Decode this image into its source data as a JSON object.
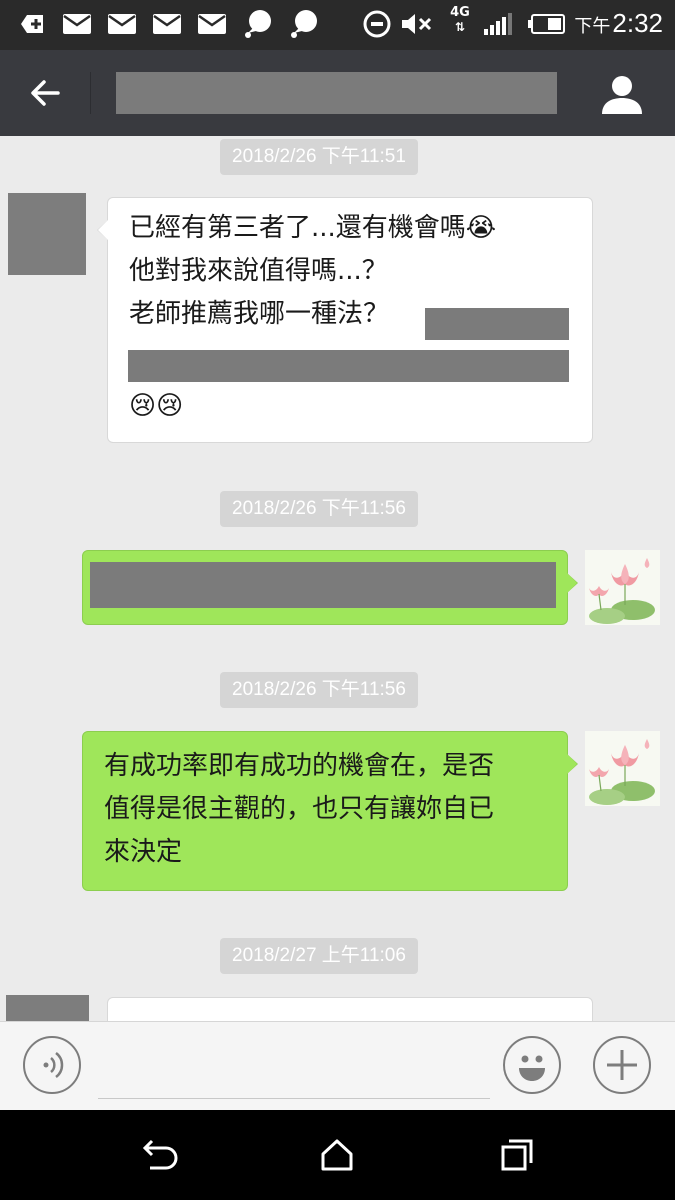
{
  "status_bar": {
    "time_prefix": "下午",
    "time": "2:32",
    "network": "4G",
    "icons": [
      "add-square-icon",
      "mail-icon",
      "mail-icon",
      "mail-icon",
      "mail-icon",
      "chat-bubble-icon",
      "chat-bubble-icon",
      "do-not-disturb-icon",
      "mute-icon",
      "network-4g-icon",
      "signal-icon",
      "battery-icon"
    ]
  },
  "header": {
    "back_icon": "arrow-left-icon",
    "profile_icon": "person-icon"
  },
  "messages": [
    {
      "timestamp": "2018/2/26 下午11:51"
    },
    {
      "sender": "contact",
      "lines": [
        "已經有第三者了...還有機會嗎😭",
        "他對我來說值得嗎...？",
        "老師推薦我哪一種法？"
      ],
      "emoji_line": "😢😢"
    },
    {
      "timestamp": "2018/2/26 下午11:56"
    },
    {
      "timestamp": "2018/2/26 下午11:56"
    },
    {
      "sender": "me",
      "lines": [
        "有成功率即有成功的機會在，是否",
        "值得是很主觀的，也只有讓妳自已",
        "來決定"
      ]
    },
    {
      "timestamp": "2018/2/27 上午11:06"
    }
  ],
  "input_bar": {
    "voice_icon": "voice-icon",
    "emoji_icon": "smiley-icon",
    "add_icon": "plus-icon",
    "input_value": ""
  },
  "nav_bar": {
    "icons": [
      "back-nav-icon",
      "home-nav-icon",
      "recents-nav-icon"
    ]
  },
  "colors": {
    "title_bar": "#393a3f",
    "chat_bg": "#ebebeb",
    "bubble_sent": "#9fe65a",
    "bubble_received": "#ffffff",
    "timestamp_bg": "#d5d5d5"
  }
}
